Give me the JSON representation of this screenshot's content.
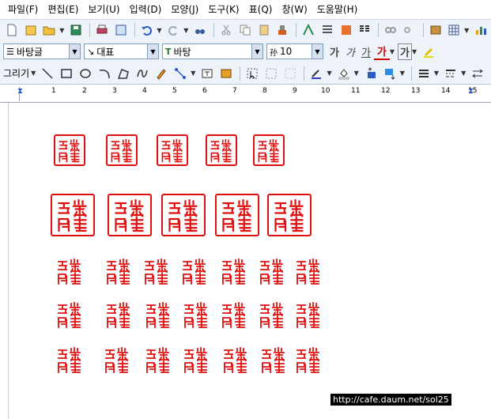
{
  "menubar": {
    "items": [
      "파일(F)",
      "편집(E)",
      "보기(U)",
      "입력(D)",
      "모양(J)",
      "도구(K)",
      "표(Q)",
      "창(W)",
      "도움말(H)"
    ]
  },
  "toolbar2": {
    "style_value": "바탕글",
    "lang_value": "대표",
    "font_value": "바탕",
    "size_value": "10",
    "size_prefix": "孙",
    "format_buttons": [
      "가",
      "가",
      "가",
      "가",
      "가"
    ]
  },
  "toolbar3": {
    "draw_label": "그리기"
  },
  "ruler": {
    "numbers": [
      "1",
      "2",
      "3",
      "4",
      "5",
      "6",
      "7",
      "8",
      "9",
      "10",
      "11",
      "12",
      "13",
      "14",
      "15"
    ]
  },
  "seals": {
    "text": "洪吉童印",
    "color": "#e01010"
  },
  "watermark": "http://cafe.daum.net/sol25",
  "colors": {
    "toolbar_bg": "#eef2f9",
    "seal_red": "#e01010"
  }
}
